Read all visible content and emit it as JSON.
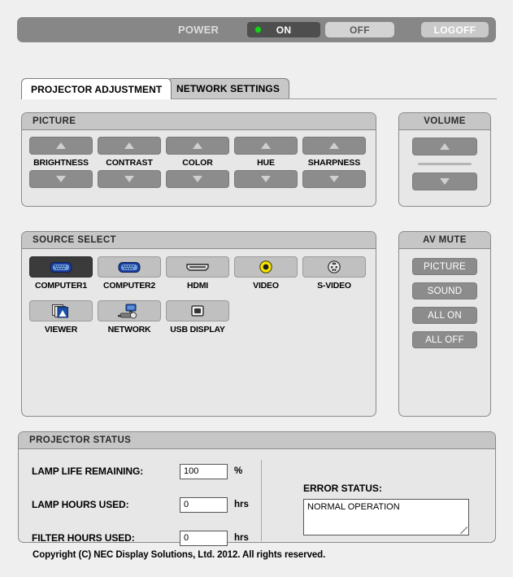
{
  "power_bar": {
    "label": "POWER",
    "on_label": "ON",
    "off_label": "OFF",
    "logoff_label": "LOGOFF",
    "state": "ON",
    "led_color": "#17d417"
  },
  "tabs": [
    {
      "label": "PROJECTOR ADJUSTMENT",
      "active": true
    },
    {
      "label": "NETWORK SETTINGS",
      "active": false
    }
  ],
  "picture": {
    "title": "PICTURE",
    "controls": [
      {
        "label": "BRIGHTNESS"
      },
      {
        "label": "CONTRAST"
      },
      {
        "label": "COLOR"
      },
      {
        "label": "HUE"
      },
      {
        "label": "SHARPNESS"
      }
    ]
  },
  "volume": {
    "title": "VOLUME",
    "up_icon": "triangle-up-icon",
    "down_icon": "triangle-down-icon"
  },
  "source_select": {
    "title": "SOURCE SELECT",
    "selected": "COMPUTER1",
    "row1": [
      {
        "label": "COMPUTER1",
        "icon": "vga-connector-icon",
        "selected": true
      },
      {
        "label": "COMPUTER2",
        "icon": "vga-connector-icon",
        "selected": false
      },
      {
        "label": "HDMI",
        "icon": "hdmi-connector-icon",
        "selected": false
      },
      {
        "label": "VIDEO",
        "icon": "rca-composite-icon",
        "selected": false
      },
      {
        "label": "S-VIDEO",
        "icon": "mini-din-icon",
        "selected": false
      }
    ],
    "row2": [
      {
        "label": "VIEWER",
        "icon": "photo-stack-icon",
        "selected": false
      },
      {
        "label": "NETWORK",
        "icon": "monitor-projector-icon",
        "selected": false
      },
      {
        "label": "USB DISPLAY",
        "icon": "usb-b-port-icon",
        "selected": false
      }
    ]
  },
  "av_mute": {
    "title": "AV MUTE",
    "buttons": [
      {
        "label": "PICTURE"
      },
      {
        "label": "SOUND"
      },
      {
        "label": "ALL ON"
      },
      {
        "label": "ALL OFF"
      }
    ]
  },
  "projector_status": {
    "title": "PROJECTOR STATUS",
    "rows": [
      {
        "key": "LAMP LIFE REMAINING:",
        "value": "100",
        "unit": "%"
      },
      {
        "key": "LAMP HOURS USED:",
        "value": "0",
        "unit": "hrs"
      },
      {
        "key": "FILTER HOURS USED:",
        "value": "0",
        "unit": "hrs"
      }
    ],
    "error_status_label": "ERROR STATUS:",
    "error_status_value": "NORMAL OPERATION"
  },
  "copyright": "Copyright (C) NEC Display Solutions, Ltd. 2012. All rights reserved."
}
